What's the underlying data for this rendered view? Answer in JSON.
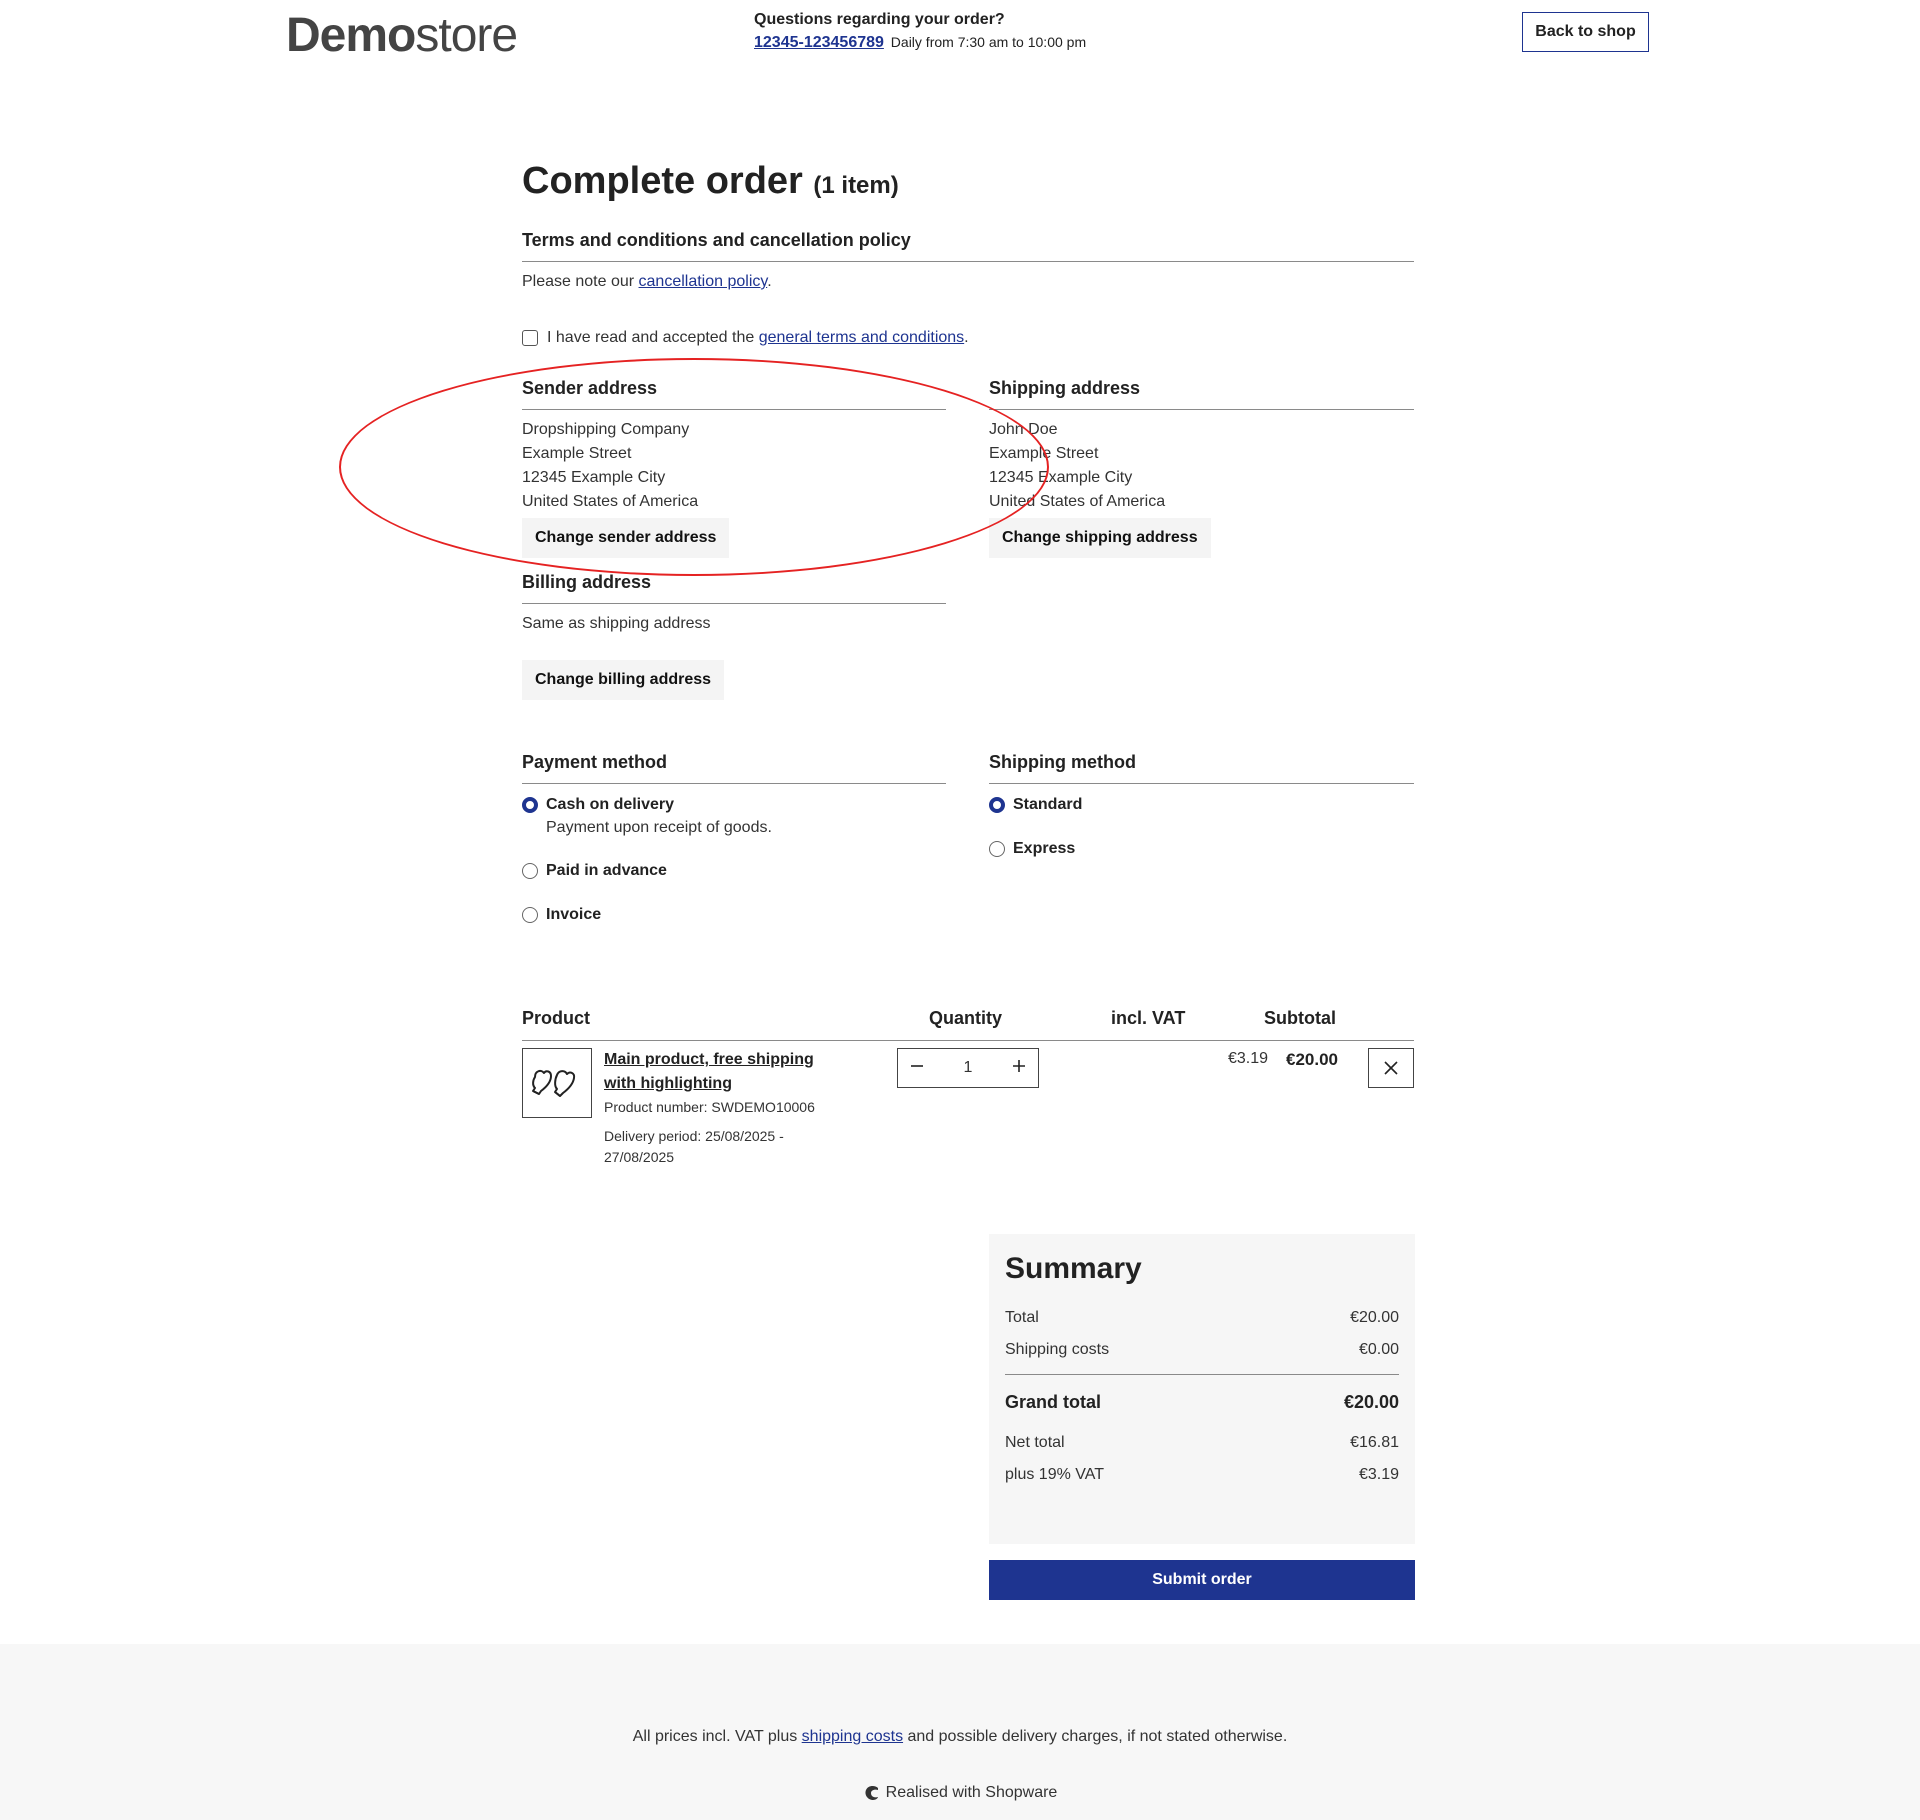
{
  "header": {
    "logo_bold": "Demo",
    "logo_light": "store",
    "contact_title": "Questions regarding your order?",
    "phone": "12345-123456789",
    "hours": "Daily from 7:30 am to 10:00 pm",
    "back_label": "Back to shop"
  },
  "page": {
    "title": "Complete order",
    "item_count": "(1 item)"
  },
  "terms": {
    "title": "Terms and conditions and cancellation policy",
    "note_prefix": "Please note our ",
    "cancellation_link": "cancellation policy",
    "note_suffix": ".",
    "check_prefix": "I have read and accepted the ",
    "gtc_link": "general terms and conditions",
    "check_suffix": "."
  },
  "sender": {
    "title": "Sender address",
    "lines": [
      "Dropshipping Company",
      "Example Street",
      "12345 Example City",
      "United States of America"
    ],
    "button": "Change sender address"
  },
  "shipping_address": {
    "title": "Shipping address",
    "lines": [
      "John Doe",
      "Example Street",
      "12345 Example City",
      "United States of America"
    ],
    "button": "Change shipping address"
  },
  "billing": {
    "title": "Billing address",
    "text": "Same as shipping address",
    "button": "Change billing address"
  },
  "payment": {
    "title": "Payment method",
    "options": [
      {
        "label": "Cash on delivery",
        "desc": "Payment upon receipt of goods.",
        "selected": true
      },
      {
        "label": "Paid in advance",
        "selected": false
      },
      {
        "label": "Invoice",
        "selected": false
      }
    ]
  },
  "shipping_method": {
    "title": "Shipping method",
    "options": [
      {
        "label": "Standard",
        "selected": true
      },
      {
        "label": "Express",
        "selected": false
      }
    ]
  },
  "cart": {
    "headers": {
      "product": "Product",
      "quantity": "Quantity",
      "vat": "incl. VAT",
      "subtotal": "Subtotal"
    },
    "item": {
      "name": "Main product, free shipping with highlighting",
      "number": "Product number: SWDEMO10006",
      "delivery": "Delivery period: 25/08/2025 - 27/08/2025",
      "quantity": "1",
      "vat": "€3.19",
      "subtotal": "€20.00",
      "icon": "gloves-icon"
    }
  },
  "summary": {
    "title": "Summary",
    "total_label": "Total",
    "total": "€20.00",
    "shipping_label": "Shipping costs",
    "shipping": "€0.00",
    "grand_label": "Grand total",
    "grand": "€20.00",
    "net_label": "Net total",
    "net": "€16.81",
    "vat_label": "plus 19% VAT",
    "vat": "€3.19",
    "submit": "Submit order"
  },
  "footer": {
    "note_prefix": "All prices incl. VAT plus ",
    "shipping_link": "shipping costs",
    "note_suffix": " and possible delivery charges, if not stated otherwise.",
    "made_with": "Realised with Shopware"
  },
  "colors": {
    "accent": "#1e3490",
    "annotation": "#e52222"
  }
}
